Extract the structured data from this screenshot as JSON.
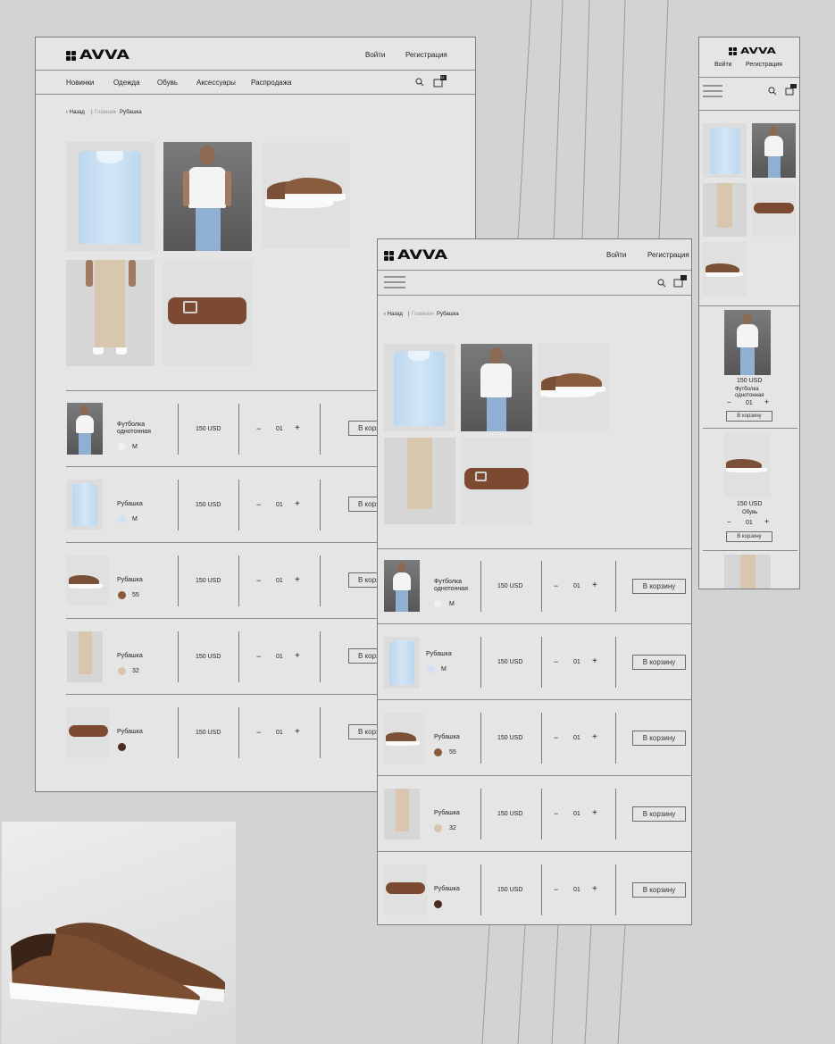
{
  "brand": {
    "logo_text": "AVVA"
  },
  "colors": {
    "background": "#d3d3d3",
    "panel": "#e5e5e5",
    "border": "#7d7d7d",
    "text": "#222222"
  },
  "header": {
    "login": "Войти",
    "register": "Регистрация",
    "nav": [
      "Новинки",
      "Одежда",
      "Обувь",
      "Аксессуары",
      "Распродажа"
    ],
    "cart_count": "22",
    "icons": [
      "search-icon",
      "cart-icon",
      "menu-icon"
    ]
  },
  "breadcrumb": {
    "back": "Назад",
    "home": "Главная",
    "current": "Рубашка"
  },
  "products": [
    {
      "name": "Футболка однотонная",
      "name_line1": "Футболка",
      "name_line2": "однотонная",
      "price": "150 USD",
      "qty": "01",
      "swatch_label": "M",
      "swatch_color": "#f1f1f1",
      "button": "В корзину",
      "image": "tshirt-model"
    },
    {
      "name": "Рубашка",
      "price": "150 USD",
      "qty": "01",
      "swatch_label": "M",
      "swatch_color": "#cfe2f5",
      "button": "В корзину",
      "image": "shirt"
    },
    {
      "name": "Рубашка",
      "price": "150 USD",
      "qty": "01",
      "swatch_label": "55",
      "swatch_color": "#8a5a3c",
      "button": "В корзину",
      "image": "shoes"
    },
    {
      "name": "Рубашка",
      "price": "150 USD",
      "qty": "01",
      "swatch_label": "32",
      "swatch_color": "#d8c4ae",
      "button": "В корзину",
      "image": "chinos"
    },
    {
      "name": "Рубашка",
      "price": "150 USD",
      "qty": "01",
      "swatch_label": "",
      "swatch_color": "#4a2a22",
      "button": "В корзину",
      "image": "belt"
    }
  ],
  "controls": {
    "minus": "−",
    "plus": "+"
  },
  "mobile": {
    "cards": [
      {
        "price": "150 USD",
        "caption_line1": "Футболка",
        "caption_line2": "однотонная",
        "qty": "01",
        "button": "В корзину"
      },
      {
        "price": "150 USD",
        "caption_line1": "Обувь",
        "qty": "01",
        "button": "В корзину"
      }
    ]
  }
}
